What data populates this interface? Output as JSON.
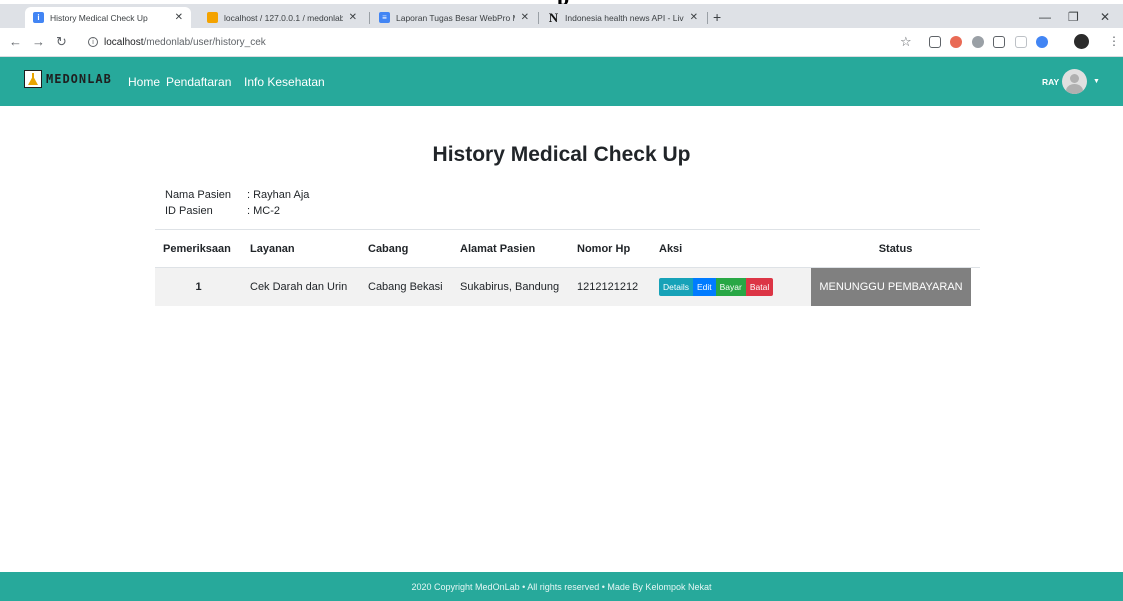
{
  "browser": {
    "top_glyph": "p",
    "tabs": [
      {
        "title": "History Medical Check Up",
        "favicon": "info-favicon",
        "color": "#4285f4",
        "active": true
      },
      {
        "title": "localhost / 127.0.0.1 / medonlab",
        "favicon": "phpmyadmin-favicon",
        "color": "#f4a300",
        "active": false
      },
      {
        "title": "Laporan Tugas Besar WebPro MS",
        "favicon": "google-docs-favicon",
        "color": "#4285f4",
        "active": false
      },
      {
        "title": "Indonesia health news API - Live",
        "favicon": "newsapi-favicon",
        "color": "#111111",
        "active": false
      }
    ],
    "url_host": "localhost",
    "url_path": "/medonlab/user/history_cek"
  },
  "navbar": {
    "brand": "MEDONLAB",
    "links": [
      "Home",
      "Pendaftaran",
      "Info Kesehatan"
    ],
    "user": "RAY"
  },
  "main": {
    "title": "History Medical Check Up",
    "patient_name_label": "Nama Pasien",
    "patient_name_value": ": Rayhan Aja",
    "patient_id_label": "ID Pasien",
    "patient_id_value": ": MC-2",
    "table": {
      "headers": [
        "Pemeriksaan",
        "Layanan",
        "Cabang",
        "Alamat Pasien",
        "Nomor Hp",
        "Aksi",
        "Status"
      ],
      "rows": [
        {
          "pemeriksaan": "1",
          "layanan": "Cek Darah dan Urin",
          "cabang": "Cabang Bekasi",
          "alamat": "Sukabirus, Bandung",
          "nomor_hp": "1212121212",
          "aksi": {
            "details": "Details",
            "edit": "Edit",
            "bayar": "Bayar",
            "batal": "Batal"
          },
          "status": "MENUNGGU PEMBAYARAN"
        }
      ]
    }
  },
  "footer": {
    "text": "2020 Copyright MedOnLab • All rights reserved • Made By Kelompok Nekat"
  },
  "colors": {
    "primary": "#27a99b",
    "status_bg": "#808080"
  }
}
